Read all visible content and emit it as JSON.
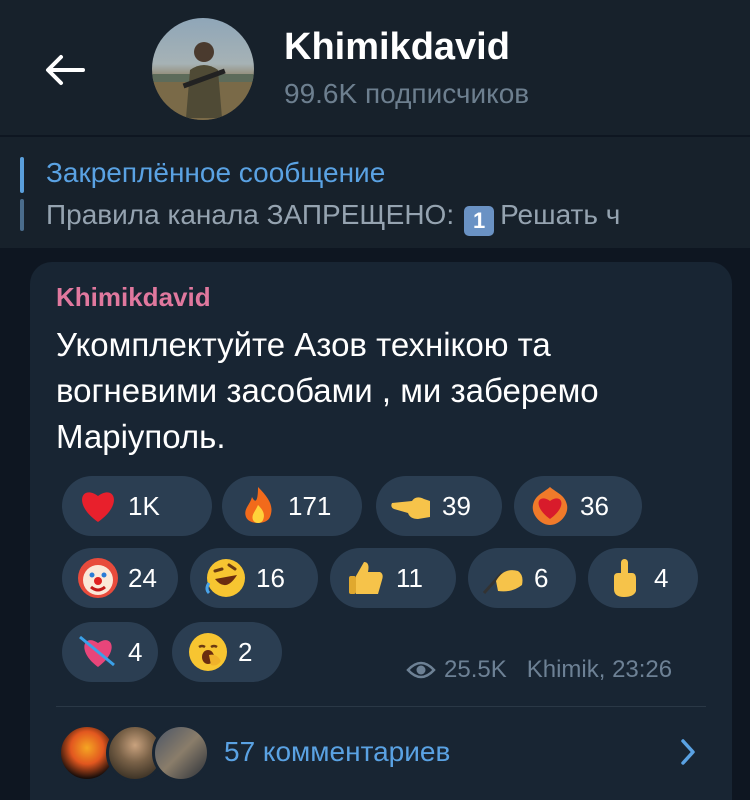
{
  "header": {
    "title": "Khimikdavid",
    "subscribers": "99.6K подписчиков"
  },
  "pinned": {
    "title": "Закреплённое сообщение",
    "text_prefix": "Правила канала   ЗАПРЕЩЕНО:",
    "number_badge": "1",
    "text_suffix": "Решать ч"
  },
  "message": {
    "author": "Khimikdavid",
    "text": "Укомплектуйте Азов технікою та вогневими засобами , ми заберемо Маріуполь.",
    "views": "25.5K",
    "signature": "Khimik, 23:26"
  },
  "reactions": [
    {
      "emoji": "red-heart",
      "count": "1K"
    },
    {
      "emoji": "fire",
      "count": "171"
    },
    {
      "emoji": "pointing-hand",
      "count": "39"
    },
    {
      "emoji": "heart-on-fire",
      "count": "36"
    },
    {
      "emoji": "clown-face",
      "count": "24"
    },
    {
      "emoji": "rolling-laughing-face",
      "count": "16"
    },
    {
      "emoji": "thumbs-up",
      "count": "11"
    },
    {
      "emoji": "writing-hand",
      "count": "6"
    },
    {
      "emoji": "middle-finger",
      "count": "4"
    },
    {
      "emoji": "heart-with-arrow",
      "count": "4"
    },
    {
      "emoji": "yawning-face",
      "count": "2"
    }
  ],
  "comments": {
    "label": "57 комментариев"
  },
  "colors": {
    "background": "#0e1621",
    "header": "#17212b",
    "bubble": "#182533",
    "accent": "#5aa2e3",
    "author": "#e0789e",
    "reaction_chip": "#2b3e52"
  }
}
